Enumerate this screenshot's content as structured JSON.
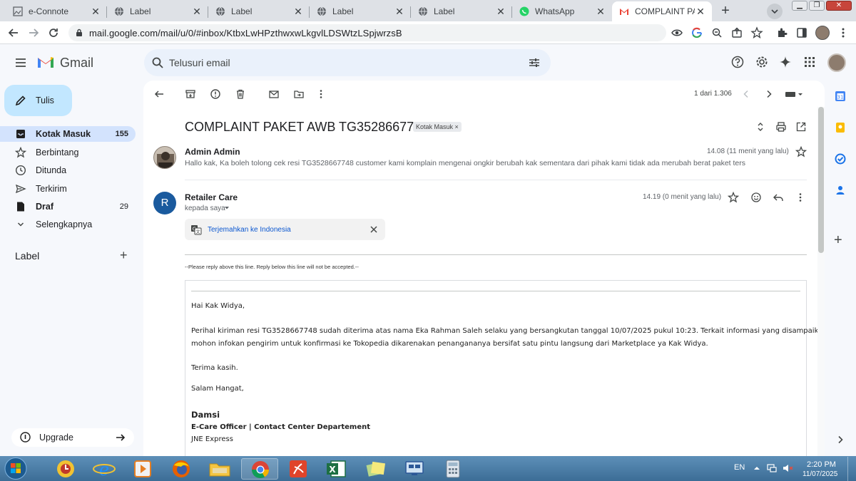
{
  "browser": {
    "tabs": [
      {
        "label": "e-Connote"
      },
      {
        "label": "Label"
      },
      {
        "label": "Label"
      },
      {
        "label": "Label"
      },
      {
        "label": "Label"
      },
      {
        "label": "WhatsApp"
      },
      {
        "label": "COMPLAINT PAKET"
      }
    ],
    "url": "mail.google.com/mail/u/0/#inbox/KtbxLwHPzthwxwLkgvlLDSWtzLSpjwrzsB"
  },
  "gmail": {
    "logo_text": "Gmail",
    "search_placeholder": "Telusuri email",
    "compose_label": "Tulis",
    "nav": [
      {
        "label": "Kotak Masuk",
        "count": "155"
      },
      {
        "label": "Berbintang",
        "count": ""
      },
      {
        "label": "Ditunda",
        "count": ""
      },
      {
        "label": "Terkirim",
        "count": ""
      },
      {
        "label": "Draf",
        "count": "29"
      },
      {
        "label": "Selengkapnya",
        "count": ""
      }
    ],
    "labels_heading": "Label",
    "upgrade_label": "Upgrade",
    "pagination": "1 dari 1.306"
  },
  "thread": {
    "subject": "COMPLAINT PAKET AWB TG3528667748",
    "label_chip": "Kotak Masuk",
    "chip_close": "×",
    "msg1": {
      "sender": "Admin Admin",
      "time": "14.08 (11 menit yang lalu)",
      "snippet": "Hallo kak, Ka boleh tolong cek resi TG3528667748 customer kami komplain mengenai ongkir berubah kak sementara dari pihak kami tidak ada merubah berat paket ters"
    },
    "msg2": {
      "avatar_letter": "R",
      "sender": "Retailer Care",
      "recipient": "kepada saya",
      "time": "14.19 (0 menit yang lalu)",
      "translate_label": "Terjemahkan ke Indonesia",
      "reply_line": "--Please reply above this line. Reply below this line will not be accepted.--",
      "greeting": "Hai Kak Widya,",
      "para1_line1": "Perihal kiriman resi TG3528667748 sudah diterima atas nama Eka Rahman Saleh selaku yang bersangkutan tanggal 10/07/2025 pukul 10:23. Terkait informasi yang disampaikan,",
      "para1_line2": "mohon infokan pengirim untuk konfirmasi ke Tokopedia dikarenakan penangananya bersifat satu pintu langsung dari Marketplace ya Kak Widya.",
      "thanks": "Terima kasih.",
      "closing": "Salam Hangat,",
      "sig_name": "Damsi",
      "sig_title": "E-Care Officer | Contact Center Departement",
      "sig_company": "JNE Express"
    }
  },
  "taskbar": {
    "language": "EN",
    "time": "2:20 PM",
    "date": "11/07/2025"
  },
  "colors": {
    "accent": "#0b57d0",
    "compose_bg": "#c2e7ff",
    "selected_nav": "#d3e3fd",
    "avatar_blue": "#1a5a9e"
  }
}
